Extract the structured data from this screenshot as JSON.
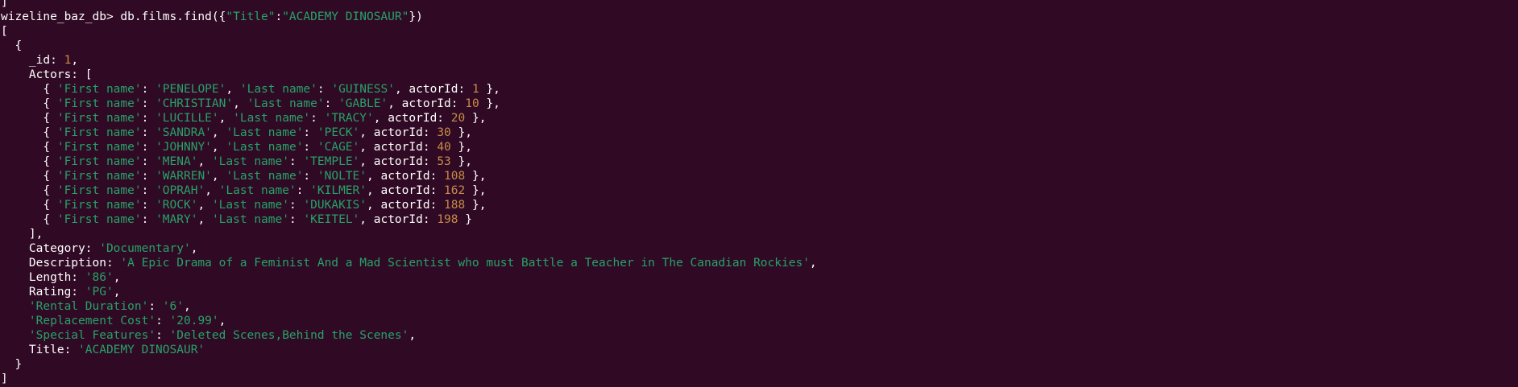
{
  "colors": {
    "background": "#300a24",
    "text": "#ffffff",
    "string": "#26a269",
    "number": "#c88b49"
  },
  "lines": [
    [
      {
        "t": "]",
        "c": "w"
      }
    ],
    [
      {
        "t": "wizeline_baz_db> db.films.find({",
        "c": "w"
      },
      {
        "t": "\"Title\"",
        "c": "s"
      },
      {
        "t": ":",
        "c": "w"
      },
      {
        "t": "\"ACADEMY DINOSAUR\"",
        "c": "s"
      },
      {
        "t": "})",
        "c": "w"
      }
    ],
    [
      {
        "t": "[",
        "c": "w"
      }
    ],
    [
      {
        "t": "  {",
        "c": "w"
      }
    ],
    [
      {
        "t": "    _id: ",
        "c": "w"
      },
      {
        "t": "1",
        "c": "n"
      },
      {
        "t": ",",
        "c": "w"
      }
    ],
    [
      {
        "t": "    Actors: [",
        "c": "w"
      }
    ],
    [
      {
        "t": "      { ",
        "c": "w"
      },
      {
        "t": "'First name'",
        "c": "s"
      },
      {
        "t": ": ",
        "c": "w"
      },
      {
        "t": "'PENELOPE'",
        "c": "s"
      },
      {
        "t": ", ",
        "c": "w"
      },
      {
        "t": "'Last name'",
        "c": "s"
      },
      {
        "t": ": ",
        "c": "w"
      },
      {
        "t": "'GUINESS'",
        "c": "s"
      },
      {
        "t": ", actorId: ",
        "c": "w"
      },
      {
        "t": "1",
        "c": "n"
      },
      {
        "t": " },",
        "c": "w"
      }
    ],
    [
      {
        "t": "      { ",
        "c": "w"
      },
      {
        "t": "'First name'",
        "c": "s"
      },
      {
        "t": ": ",
        "c": "w"
      },
      {
        "t": "'CHRISTIAN'",
        "c": "s"
      },
      {
        "t": ", ",
        "c": "w"
      },
      {
        "t": "'Last name'",
        "c": "s"
      },
      {
        "t": ": ",
        "c": "w"
      },
      {
        "t": "'GABLE'",
        "c": "s"
      },
      {
        "t": ", actorId: ",
        "c": "w"
      },
      {
        "t": "10",
        "c": "n"
      },
      {
        "t": " },",
        "c": "w"
      }
    ],
    [
      {
        "t": "      { ",
        "c": "w"
      },
      {
        "t": "'First name'",
        "c": "s"
      },
      {
        "t": ": ",
        "c": "w"
      },
      {
        "t": "'LUCILLE'",
        "c": "s"
      },
      {
        "t": ", ",
        "c": "w"
      },
      {
        "t": "'Last name'",
        "c": "s"
      },
      {
        "t": ": ",
        "c": "w"
      },
      {
        "t": "'TRACY'",
        "c": "s"
      },
      {
        "t": ", actorId: ",
        "c": "w"
      },
      {
        "t": "20",
        "c": "n"
      },
      {
        "t": " },",
        "c": "w"
      }
    ],
    [
      {
        "t": "      { ",
        "c": "w"
      },
      {
        "t": "'First name'",
        "c": "s"
      },
      {
        "t": ": ",
        "c": "w"
      },
      {
        "t": "'SANDRA'",
        "c": "s"
      },
      {
        "t": ", ",
        "c": "w"
      },
      {
        "t": "'Last name'",
        "c": "s"
      },
      {
        "t": ": ",
        "c": "w"
      },
      {
        "t": "'PECK'",
        "c": "s"
      },
      {
        "t": ", actorId: ",
        "c": "w"
      },
      {
        "t": "30",
        "c": "n"
      },
      {
        "t": " },",
        "c": "w"
      }
    ],
    [
      {
        "t": "      { ",
        "c": "w"
      },
      {
        "t": "'First name'",
        "c": "s"
      },
      {
        "t": ": ",
        "c": "w"
      },
      {
        "t": "'JOHNNY'",
        "c": "s"
      },
      {
        "t": ", ",
        "c": "w"
      },
      {
        "t": "'Last name'",
        "c": "s"
      },
      {
        "t": ": ",
        "c": "w"
      },
      {
        "t": "'CAGE'",
        "c": "s"
      },
      {
        "t": ", actorId: ",
        "c": "w"
      },
      {
        "t": "40",
        "c": "n"
      },
      {
        "t": " },",
        "c": "w"
      }
    ],
    [
      {
        "t": "      { ",
        "c": "w"
      },
      {
        "t": "'First name'",
        "c": "s"
      },
      {
        "t": ": ",
        "c": "w"
      },
      {
        "t": "'MENA'",
        "c": "s"
      },
      {
        "t": ", ",
        "c": "w"
      },
      {
        "t": "'Last name'",
        "c": "s"
      },
      {
        "t": ": ",
        "c": "w"
      },
      {
        "t": "'TEMPLE'",
        "c": "s"
      },
      {
        "t": ", actorId: ",
        "c": "w"
      },
      {
        "t": "53",
        "c": "n"
      },
      {
        "t": " },",
        "c": "w"
      }
    ],
    [
      {
        "t": "      { ",
        "c": "w"
      },
      {
        "t": "'First name'",
        "c": "s"
      },
      {
        "t": ": ",
        "c": "w"
      },
      {
        "t": "'WARREN'",
        "c": "s"
      },
      {
        "t": ", ",
        "c": "w"
      },
      {
        "t": "'Last name'",
        "c": "s"
      },
      {
        "t": ": ",
        "c": "w"
      },
      {
        "t": "'NOLTE'",
        "c": "s"
      },
      {
        "t": ", actorId: ",
        "c": "w"
      },
      {
        "t": "108",
        "c": "n"
      },
      {
        "t": " },",
        "c": "w"
      }
    ],
    [
      {
        "t": "      { ",
        "c": "w"
      },
      {
        "t": "'First name'",
        "c": "s"
      },
      {
        "t": ": ",
        "c": "w"
      },
      {
        "t": "'OPRAH'",
        "c": "s"
      },
      {
        "t": ", ",
        "c": "w"
      },
      {
        "t": "'Last name'",
        "c": "s"
      },
      {
        "t": ": ",
        "c": "w"
      },
      {
        "t": "'KILMER'",
        "c": "s"
      },
      {
        "t": ", actorId: ",
        "c": "w"
      },
      {
        "t": "162",
        "c": "n"
      },
      {
        "t": " },",
        "c": "w"
      }
    ],
    [
      {
        "t": "      { ",
        "c": "w"
      },
      {
        "t": "'First name'",
        "c": "s"
      },
      {
        "t": ": ",
        "c": "w"
      },
      {
        "t": "'ROCK'",
        "c": "s"
      },
      {
        "t": ", ",
        "c": "w"
      },
      {
        "t": "'Last name'",
        "c": "s"
      },
      {
        "t": ": ",
        "c": "w"
      },
      {
        "t": "'DUKAKIS'",
        "c": "s"
      },
      {
        "t": ", actorId: ",
        "c": "w"
      },
      {
        "t": "188",
        "c": "n"
      },
      {
        "t": " },",
        "c": "w"
      }
    ],
    [
      {
        "t": "      { ",
        "c": "w"
      },
      {
        "t": "'First name'",
        "c": "s"
      },
      {
        "t": ": ",
        "c": "w"
      },
      {
        "t": "'MARY'",
        "c": "s"
      },
      {
        "t": ", ",
        "c": "w"
      },
      {
        "t": "'Last name'",
        "c": "s"
      },
      {
        "t": ": ",
        "c": "w"
      },
      {
        "t": "'KEITEL'",
        "c": "s"
      },
      {
        "t": ", actorId: ",
        "c": "w"
      },
      {
        "t": "198",
        "c": "n"
      },
      {
        "t": " }",
        "c": "w"
      }
    ],
    [
      {
        "t": "    ],",
        "c": "w"
      }
    ],
    [
      {
        "t": "    Category: ",
        "c": "w"
      },
      {
        "t": "'Documentary'",
        "c": "s"
      },
      {
        "t": ",",
        "c": "w"
      }
    ],
    [
      {
        "t": "    Description: ",
        "c": "w"
      },
      {
        "t": "'A Epic Drama of a Feminist And a Mad Scientist who must Battle a Teacher in The Canadian Rockies'",
        "c": "s"
      },
      {
        "t": ",",
        "c": "w"
      }
    ],
    [
      {
        "t": "    Length: ",
        "c": "w"
      },
      {
        "t": "'86'",
        "c": "s"
      },
      {
        "t": ",",
        "c": "w"
      }
    ],
    [
      {
        "t": "    Rating: ",
        "c": "w"
      },
      {
        "t": "'PG'",
        "c": "s"
      },
      {
        "t": ",",
        "c": "w"
      }
    ],
    [
      {
        "t": "    ",
        "c": "w"
      },
      {
        "t": "'Rental Duration'",
        "c": "s"
      },
      {
        "t": ": ",
        "c": "w"
      },
      {
        "t": "'6'",
        "c": "s"
      },
      {
        "t": ",",
        "c": "w"
      }
    ],
    [
      {
        "t": "    ",
        "c": "w"
      },
      {
        "t": "'Replacement Cost'",
        "c": "s"
      },
      {
        "t": ": ",
        "c": "w"
      },
      {
        "t": "'20.99'",
        "c": "s"
      },
      {
        "t": ",",
        "c": "w"
      }
    ],
    [
      {
        "t": "    ",
        "c": "w"
      },
      {
        "t": "'Special Features'",
        "c": "s"
      },
      {
        "t": ": ",
        "c": "w"
      },
      {
        "t": "'Deleted Scenes,Behind the Scenes'",
        "c": "s"
      },
      {
        "t": ",",
        "c": "w"
      }
    ],
    [
      {
        "t": "    Title: ",
        "c": "w"
      },
      {
        "t": "'ACADEMY DINOSAUR'",
        "c": "s"
      }
    ],
    [
      {
        "t": "  }",
        "c": "w"
      }
    ],
    [
      {
        "t": "]",
        "c": "w"
      }
    ]
  ]
}
